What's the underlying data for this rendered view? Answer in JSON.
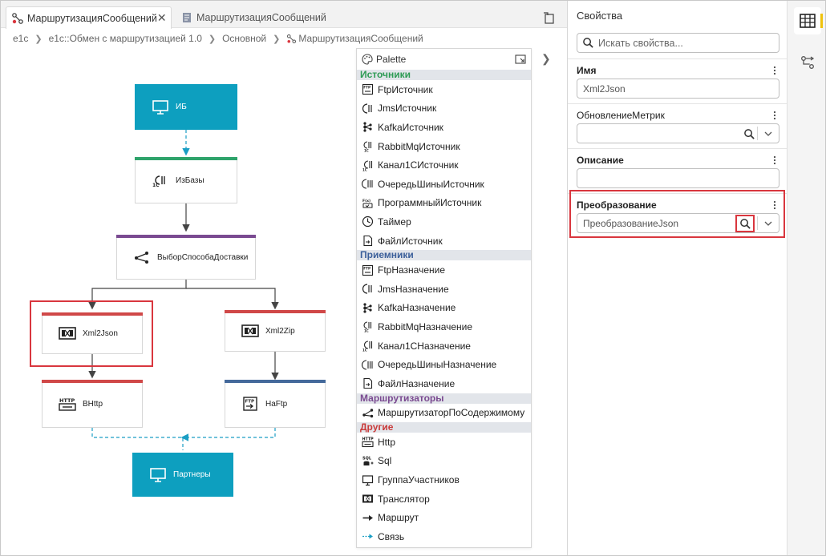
{
  "tabs": [
    {
      "label": "МаршрутизацияСообщений",
      "active": true
    },
    {
      "label": "МаршрутизацияСообщений",
      "active": false
    }
  ],
  "breadcrumb": [
    "e1c",
    "e1c::Обмен с маршрутизацией 1.0",
    "Основной",
    "МаршрутизацияСообщений"
  ],
  "diagram": {
    "nodes": {
      "ib": "ИБ",
      "iz_bazy": "ИзБазы",
      "vybor": "ВыборСпособаДоставки",
      "xml2json": "Xml2Json",
      "xml2zip": "Xml2Zip",
      "vhttp": "ВHttp",
      "naftp": "НаFtp",
      "partnery": "Партнеры"
    },
    "colors": {
      "ib": "#0d9fbf",
      "green": "#2ea36b",
      "purple": "#7a4a91",
      "red": "#d04848",
      "blue": "#44699b"
    }
  },
  "palette": {
    "title": "Palette",
    "sections": [
      {
        "title": "Источники",
        "color": "#2e9b55",
        "items": [
          "FtpИсточник",
          "JmsИсточник",
          "KafkaИсточник",
          "RabbitMqИсточник",
          "Канал1СИсточник",
          "ОчередьШиныИсточник",
          "ПрограммныйИсточник",
          "Таймер",
          "ФайлИсточник"
        ]
      },
      {
        "title": "Приемники",
        "color": "#3b5f9a",
        "items": [
          "FtpНазначение",
          "JmsНазначение",
          "KafkaНазначение",
          "RabbitMqНазначение",
          "Канал1СНазначение",
          "ОчередьШиныНазначение",
          "ФайлНазначение"
        ]
      },
      {
        "title": "Маршрутизаторы",
        "color": "#7a4a91",
        "items": [
          "МаршрутизаторПоСодержимому"
        ]
      },
      {
        "title": "Другие",
        "color": "#c93a3a",
        "items": [
          "Http",
          "Sql",
          "ГруппаУчастников",
          "Транслятор",
          "Маршрут",
          "Связь"
        ]
      }
    ]
  },
  "properties": {
    "title": "Свойства",
    "search_placeholder": "Искать свойства...",
    "name_label": "Имя",
    "name_value": "Xml2Json",
    "metrics_label": "ОбновлениеМетрик",
    "metrics_value": "",
    "desc_label": "Описание",
    "desc_value": "",
    "transform_label": "Преобразование",
    "transform_value": "ПреобразованиеJson"
  }
}
